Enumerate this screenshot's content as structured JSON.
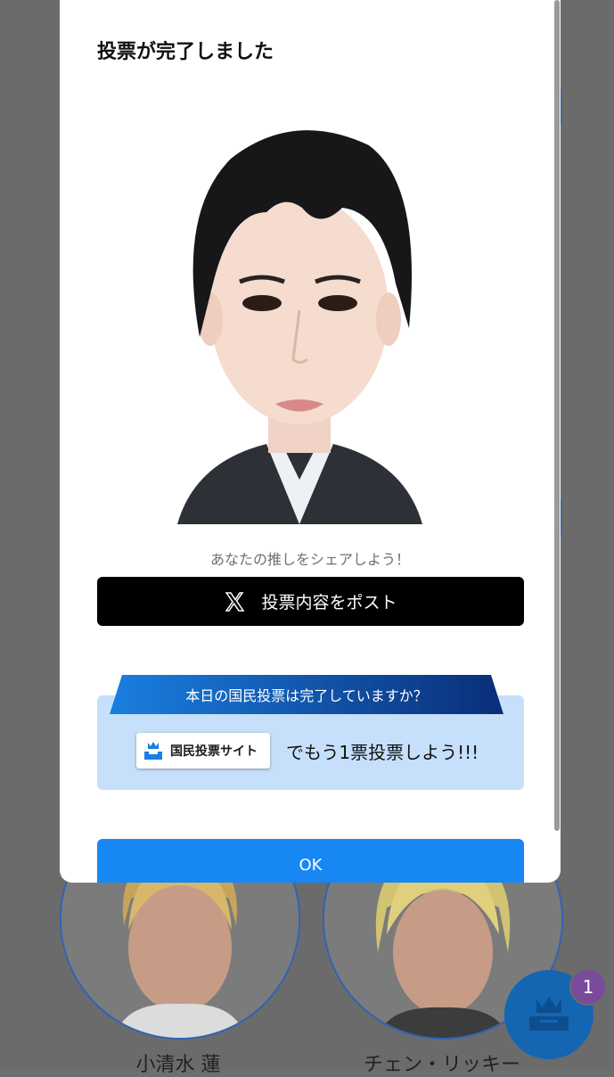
{
  "modal": {
    "title": "投票が完了しました",
    "share_prompt": "あなたの推しをシェアしよう！",
    "post_button_label": "投票内容をポスト",
    "promo_question": "本日の国民投票は完了していますか？",
    "site_chip_label": "国民投票サイト",
    "promo_message": "でもう1票投票しよう!!!",
    "ok_label": "OK"
  },
  "background": {
    "cards": [
      {
        "name": "小清水 蓮"
      },
      {
        "name": "チェン・リッキー"
      }
    ],
    "notification_count": "1"
  },
  "colors": {
    "accent_blue": "#1787f4",
    "promo_bg": "#c6e0fb",
    "promo_tab": "#0b3d8c",
    "overlay": "#6b6b6b"
  },
  "icons": [
    "x-logo-icon",
    "crown-ballot-icon"
  ]
}
